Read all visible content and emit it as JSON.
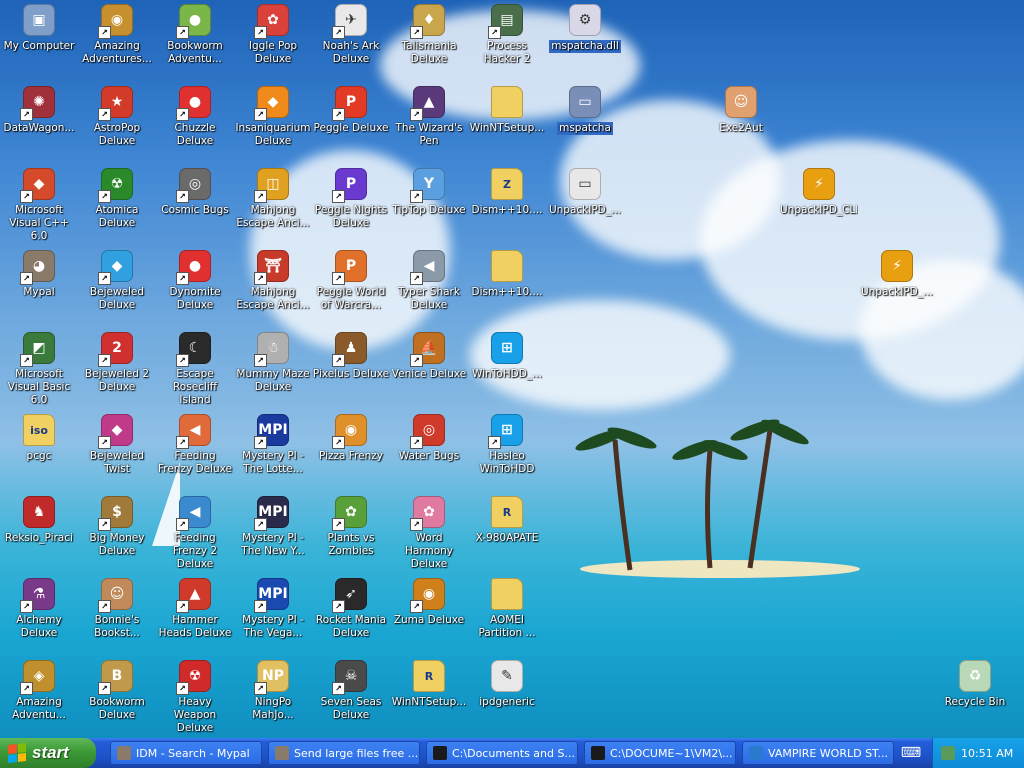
{
  "desktop": {
    "icons": [
      {
        "label": "My Computer",
        "icon": "computer-icon",
        "color": "#7f9fc8",
        "glyph": "▣",
        "shortcut": false
      },
      {
        "label": "Amazing Adventures...",
        "icon": "globe-icon",
        "color": "#c7902e",
        "glyph": "◉",
        "shortcut": true
      },
      {
        "label": "Bookworm Adventu...",
        "icon": "bookworm-icon",
        "color": "#7ab648",
        "glyph": "●",
        "shortcut": true
      },
      {
        "label": "Iggle Pop Deluxe",
        "icon": "iggle-pop-icon",
        "color": "#d9413a",
        "glyph": "✿",
        "shortcut": true
      },
      {
        "label": "Noah's Ark Deluxe",
        "icon": "dove-icon",
        "color": "#e8e8e8",
        "glyph": "✈",
        "shortcut": true
      },
      {
        "label": "Talismania Deluxe",
        "icon": "talismania-icon",
        "color": "#c9a54b",
        "glyph": "♦",
        "shortcut": true
      },
      {
        "label": "Process Hacker 2",
        "icon": "process-hacker-icon",
        "color": "#4a6e4a",
        "glyph": "▤",
        "shortcut": true
      },
      {
        "label": "mspatcha.dll",
        "icon": "dll-file-icon",
        "color": "#d8d8e8",
        "glyph": "⚙",
        "shortcut": false,
        "selected": true
      },
      {
        "label": "DataWagon...",
        "icon": "datawagon-icon",
        "color": "#a0303a",
        "glyph": "✺",
        "shortcut": true
      },
      {
        "label": "AstroPop Deluxe",
        "icon": "astropop-icon",
        "color": "#d23b2a",
        "glyph": "★",
        "shortcut": true
      },
      {
        "label": "Chuzzle Deluxe",
        "icon": "chuzzle-icon",
        "color": "#e03030",
        "glyph": "●",
        "shortcut": true
      },
      {
        "label": "Insaniquarium Deluxe",
        "icon": "fish-icon",
        "color": "#f08a1a",
        "glyph": "◆",
        "shortcut": true
      },
      {
        "label": "Peggle Deluxe",
        "icon": "peggle-icon",
        "color": "#e23a25",
        "glyph": "P",
        "shortcut": true
      },
      {
        "label": "The Wizard's Pen",
        "icon": "wizard-icon",
        "color": "#5a3a7a",
        "glyph": "▲",
        "shortcut": true
      },
      {
        "label": "WinNTSetup...",
        "icon": "folder-icon",
        "color": "#f0d060",
        "glyph": "",
        "shortcut": false
      },
      {
        "label": "mspatcha",
        "icon": "window-app-icon",
        "color": "#7a8fb8",
        "glyph": "▭",
        "shortcut": false,
        "selected": true
      },
      {
        "label": "Exe2Aut",
        "icon": "exe2aut-icon",
        "color": "#e0a070",
        "glyph": "☺",
        "shortcut": false
      },
      {
        "label": "Microsoft Visual C++ 6.0",
        "icon": "visual-cpp-icon",
        "color": "#d44a2a",
        "glyph": "◆",
        "shortcut": true
      },
      {
        "label": "Atomica Deluxe",
        "icon": "atomica-icon",
        "color": "#2a8a2a",
        "glyph": "☢",
        "shortcut": true
      },
      {
        "label": "Cosmic Bugs",
        "icon": "cosmic-bugs-icon",
        "color": "#6a6a6a",
        "glyph": "◎",
        "shortcut": true
      },
      {
        "label": "Mahjong Escape Anci...",
        "icon": "mahjong-icon",
        "color": "#e0a020",
        "glyph": "◫",
        "shortcut": true
      },
      {
        "label": "Peggle Nights Deluxe",
        "icon": "peggle-nights-icon",
        "color": "#6a3ad0",
        "glyph": "P",
        "shortcut": true
      },
      {
        "label": "TipTop Deluxe",
        "icon": "tiptop-icon",
        "color": "#5aa0e0",
        "glyph": "Y",
        "shortcut": true
      },
      {
        "label": "Dism++10....",
        "icon": "zip-folder-icon",
        "color": "#f0d060",
        "glyph": "Z",
        "shortcut": false
      },
      {
        "label": "UnpackIPD_...",
        "icon": "exe-window-icon",
        "color": "#e8e8e8",
        "glyph": "▭",
        "shortcut": false
      },
      {
        "label": "UnpackIPD_CLI",
        "icon": "lightning-icon",
        "color": "#e8a010",
        "glyph": "⚡",
        "shortcut": false
      },
      {
        "label": "Mypal",
        "icon": "raccoon-icon",
        "color": "#8a7a6a",
        "glyph": "◕",
        "shortcut": true
      },
      {
        "label": "Bejeweled Deluxe",
        "icon": "gem-icon",
        "color": "#30a0e0",
        "glyph": "◆",
        "shortcut": true
      },
      {
        "label": "Dynomite Deluxe",
        "icon": "dynomite-icon",
        "color": "#e03030",
        "glyph": "●",
        "shortcut": true
      },
      {
        "label": "Mahjong Escape Anci...",
        "icon": "torii-icon",
        "color": "#c83a2a",
        "glyph": "⛩",
        "shortcut": true
      },
      {
        "label": "Peggle World of Warcra...",
        "icon": "peggle-wow-icon",
        "color": "#e0702a",
        "glyph": "P",
        "shortcut": true
      },
      {
        "label": "Typer Shark Deluxe",
        "icon": "shark-icon",
        "color": "#8a9aa8",
        "glyph": "◀",
        "shortcut": true
      },
      {
        "label": "Dism++10....",
        "icon": "folder-icon",
        "color": "#f0d060",
        "glyph": "",
        "shortcut": false
      },
      {
        "label": "UnpackIPD_...",
        "icon": "lightning-icon",
        "color": "#e8a010",
        "glyph": "⚡",
        "shortcut": false
      },
      {
        "label": "Microsoft Visual Basic 6.0",
        "icon": "visual-basic-icon",
        "color": "#3a7a3a",
        "glyph": "◩",
        "shortcut": true
      },
      {
        "label": "Bejeweled 2 Deluxe",
        "icon": "bejeweled2-icon",
        "color": "#d03030",
        "glyph": "2",
        "shortcut": true
      },
      {
        "label": "Escape Rosecliff Island",
        "icon": "moon-icon",
        "color": "#2a2a2a",
        "glyph": "☾",
        "shortcut": true
      },
      {
        "label": "Mummy Maze Deluxe",
        "icon": "mummy-icon",
        "color": "#b0b0b0",
        "glyph": "☃",
        "shortcut": true
      },
      {
        "label": "Pixelus Deluxe",
        "icon": "pixelus-icon",
        "color": "#8a5a2a",
        "glyph": "♟",
        "shortcut": true
      },
      {
        "label": "Venice Deluxe",
        "icon": "gondola-icon",
        "color": "#c07020",
        "glyph": "⛵",
        "shortcut": true
      },
      {
        "label": "WinToHDD_...",
        "icon": "windows-logo-icon",
        "color": "#18a0e8",
        "glyph": "⊞",
        "shortcut": false
      },
      {
        "label": "pcgc",
        "icon": "iso-file-icon",
        "color": "#f0d060",
        "glyph": "iso",
        "shortcut": false
      },
      {
        "label": "Bejeweled Twist",
        "icon": "bejeweled-twist-icon",
        "color": "#c03a8a",
        "glyph": "◆",
        "shortcut": true
      },
      {
        "label": "Feeding Frenzy Deluxe",
        "icon": "feeding-frenzy-icon",
        "color": "#e06a3a",
        "glyph": "◀",
        "shortcut": true
      },
      {
        "label": "Mystery PI - The Lotte...",
        "icon": "mystery-pi-icon",
        "color": "#1a3aa0",
        "glyph": "MPI",
        "shortcut": true
      },
      {
        "label": "Pizza Frenzy",
        "icon": "pizza-icon",
        "color": "#e0902a",
        "glyph": "◉",
        "shortcut": true
      },
      {
        "label": "Water Bugs",
        "icon": "water-bugs-icon",
        "color": "#d03a2a",
        "glyph": "◎",
        "shortcut": true
      },
      {
        "label": "Hasleo WinToHDD",
        "icon": "windows-logo-icon",
        "color": "#18a0e8",
        "glyph": "⊞",
        "shortcut": true
      },
      {
        "label": "Reksio_Piraci",
        "icon": "reksio-icon",
        "color": "#c02a2a",
        "glyph": "♞",
        "shortcut": false
      },
      {
        "label": "Big Money Deluxe",
        "icon": "money-bag-icon",
        "color": "#a07a3a",
        "glyph": "$",
        "shortcut": true
      },
      {
        "label": "Feeding Frenzy 2 Deluxe",
        "icon": "feeding-frenzy2-icon",
        "color": "#3a8ad0",
        "glyph": "◀",
        "shortcut": true
      },
      {
        "label": "Mystery PI - The New Y...",
        "icon": "mystery-pi-ny-icon",
        "color": "#2a2a4a",
        "glyph": "MPI",
        "shortcut": true
      },
      {
        "label": "Plants vs Zombies",
        "icon": "plants-icon",
        "color": "#5aa03a",
        "glyph": "✿",
        "shortcut": true
      },
      {
        "label": "Word Harmony Deluxe",
        "icon": "flower-icon",
        "color": "#e07aa0",
        "glyph": "✿",
        "shortcut": true
      },
      {
        "label": "X-980APATE",
        "icon": "registry-folder-icon",
        "color": "#f0d060",
        "glyph": "R",
        "shortcut": false
      },
      {
        "label": "Alchemy Deluxe",
        "icon": "alchemy-icon",
        "color": "#7a3a8a",
        "glyph": "⚗",
        "shortcut": true
      },
      {
        "label": "Bonnie's Bookst...",
        "icon": "bonnie-icon",
        "color": "#c08a5a",
        "glyph": "☺",
        "shortcut": true
      },
      {
        "label": "Hammer Heads Deluxe",
        "icon": "hammer-heads-icon",
        "color": "#d03a2a",
        "glyph": "▲",
        "shortcut": true
      },
      {
        "label": "Mystery PI - The Vega...",
        "icon": "mystery-pi-vegas-icon",
        "color": "#1a4ab0",
        "glyph": "MPI",
        "shortcut": true
      },
      {
        "label": "Rocket Mania Deluxe",
        "icon": "rocket-icon",
        "color": "#2a2a2a",
        "glyph": "➶",
        "shortcut": true
      },
      {
        "label": "Zuma Deluxe",
        "icon": "zuma-icon",
        "color": "#d0801a",
        "glyph": "◉",
        "shortcut": true
      },
      {
        "label": "AOMEI Partition ...",
        "icon": "folder-icon",
        "color": "#f0d060",
        "glyph": "",
        "shortcut": false
      },
      {
        "label": "Amazing Adventu...",
        "icon": "amazing-adventures-icon",
        "color": "#c0902e",
        "glyph": "◈",
        "shortcut": true
      },
      {
        "label": "Bookworm Deluxe",
        "icon": "bookworm-deluxe-icon",
        "color": "#c09a4a",
        "glyph": "B",
        "shortcut": true
      },
      {
        "label": "Heavy Weapon Deluxe",
        "icon": "radiation-icon",
        "color": "#d02a2a",
        "glyph": "☢",
        "shortcut": true
      },
      {
        "label": "NingPo MahJo...",
        "icon": "ningpo-icon",
        "color": "#e0c060",
        "glyph": "NP",
        "shortcut": true
      },
      {
        "label": "Seven Seas Deluxe",
        "icon": "skull-icon",
        "color": "#4a4a4a",
        "glyph": "☠",
        "shortcut": true
      },
      {
        "label": "WinNTSetup...",
        "icon": "registry-folder-icon",
        "color": "#f0d060",
        "glyph": "R",
        "shortcut": false
      },
      {
        "label": "ipdgeneric",
        "icon": "document-pen-icon",
        "color": "#e8e8e8",
        "glyph": "✎",
        "shortcut": false
      },
      {
        "label": "Recycle Bin",
        "icon": "recycle-bin-icon",
        "color": "#b8d8b8",
        "glyph": "♻",
        "shortcut": false
      }
    ]
  },
  "taskbar": {
    "start_label": "start",
    "tasks": [
      {
        "label": "IDM - Search - Mypal",
        "icon": "raccoon-icon",
        "color": "#8a7a6a"
      },
      {
        "label": "Send large files free ...",
        "icon": "raccoon-icon",
        "color": "#8a7a6a"
      },
      {
        "label": "C:\\Documents and S...",
        "icon": "7zip-icon",
        "color": "#1a1a1a"
      },
      {
        "label": "C:\\DOCUME~1\\VM2\\...",
        "icon": "7zip-icon",
        "color": "#1a1a1a"
      },
      {
        "label": "VAMPIRE WORLD ST...",
        "icon": "ie-icon",
        "color": "#2a7ad0"
      }
    ],
    "keyboard_icon": "keyboard-icon",
    "tray_icon": "tray-app-icon",
    "clock": "10:51 AM"
  }
}
